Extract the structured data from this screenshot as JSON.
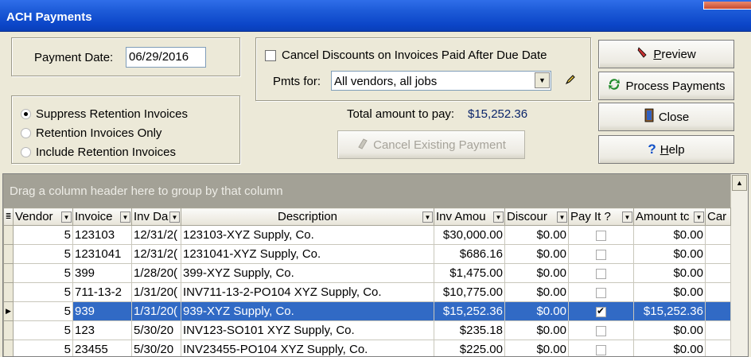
{
  "window": {
    "title": "ACH Payments"
  },
  "payment_date": {
    "label": "Payment Date:",
    "value": "06/29/2016"
  },
  "retention": {
    "options": [
      {
        "label": "Suppress Retention Invoices",
        "checked": true
      },
      {
        "label": "Retention Invoices Only",
        "checked": false
      },
      {
        "label": "Include Retention  Invoices",
        "checked": false
      }
    ]
  },
  "options": {
    "cancel_discounts_label": "Cancel Discounts on Invoices Paid After Due Date",
    "pmts_for_label": "Pmts for:",
    "pmts_for_value": "All vendors, all jobs"
  },
  "total": {
    "label": "Total amount to pay:",
    "value": "$15,252.36",
    "value_color": "#0A246A"
  },
  "buttons": {
    "cancel_existing": "Cancel Existing Payment",
    "preview_u": "P",
    "preview_rest": "review",
    "process": "Process Payments",
    "close": "Close",
    "help_u": "H",
    "help_rest": "elp"
  },
  "grid": {
    "group_hint": "Drag a column header here to group by that column",
    "columns": [
      "Vendor",
      "Invoice",
      "Inv Da",
      "Description",
      "Inv Amou",
      "Discour",
      "Pay It ?",
      "Amount tc",
      "Car"
    ],
    "rows": [
      {
        "vendor": "5",
        "invoice": "123103",
        "date": "12/31/2(",
        "description": "123103-XYZ Supply, Co.",
        "amount": "$30,000.00",
        "discount": "$0.00",
        "pay": false,
        "amount_to": "$0.00",
        "selected": false
      },
      {
        "vendor": "5",
        "invoice": "1231041",
        "date": "12/31/2(",
        "description": "1231041-XYZ Supply, Co.",
        "amount": "$686.16",
        "discount": "$0.00",
        "pay": false,
        "amount_to": "$0.00",
        "selected": false
      },
      {
        "vendor": "5",
        "invoice": "399",
        "date": "1/28/20(",
        "description": "399-XYZ Supply, Co.",
        "amount": "$1,475.00",
        "discount": "$0.00",
        "pay": false,
        "amount_to": "$0.00",
        "selected": false
      },
      {
        "vendor": "5",
        "invoice": "711-13-2",
        "date": "1/31/20(",
        "description": "INV711-13-2-PO104 XYZ Supply, Co.",
        "amount": "$10,775.00",
        "discount": "$0.00",
        "pay": false,
        "amount_to": "$0.00",
        "selected": false
      },
      {
        "vendor": "5",
        "invoice": "939",
        "date": "1/31/20(",
        "description": "939-XYZ Supply, Co.",
        "amount": "$15,252.36",
        "discount": "$0.00",
        "pay": true,
        "amount_to": "$15,252.36",
        "selected": true
      },
      {
        "vendor": "5",
        "invoice": "123",
        "date": "5/30/20",
        "description": "INV123-SO101 XYZ Supply, Co.",
        "amount": "$235.18",
        "discount": "$0.00",
        "pay": false,
        "amount_to": "$0.00",
        "selected": false
      },
      {
        "vendor": "5",
        "invoice": "23455",
        "date": "5/30/20",
        "description": "INV23455-PO104 XYZ Supply, Co.",
        "amount": "$225.00",
        "discount": "$0.00",
        "pay": false,
        "amount_to": "$0.00",
        "selected": false
      }
    ]
  }
}
